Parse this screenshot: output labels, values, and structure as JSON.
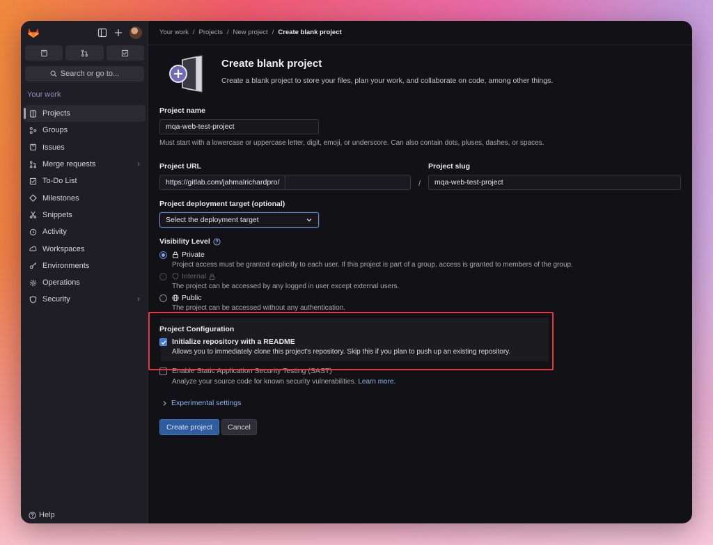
{
  "breadcrumb": [
    "Your work",
    "Projects",
    "New project",
    "Create blank project"
  ],
  "sidebar": {
    "search_label": "Search or go to...",
    "section_label": "Your work",
    "items": [
      {
        "label": "Projects",
        "icon": "project-icon",
        "active": true,
        "chevron": false
      },
      {
        "label": "Groups",
        "icon": "group-icon",
        "active": false,
        "chevron": false
      },
      {
        "label": "Issues",
        "icon": "issues-icon",
        "active": false,
        "chevron": false
      },
      {
        "label": "Merge requests",
        "icon": "merge-request-icon",
        "active": false,
        "chevron": true
      },
      {
        "label": "To-Do List",
        "icon": "todo-icon",
        "active": false,
        "chevron": false
      },
      {
        "label": "Milestones",
        "icon": "milestone-icon",
        "active": false,
        "chevron": false
      },
      {
        "label": "Snippets",
        "icon": "snippet-icon",
        "active": false,
        "chevron": false
      },
      {
        "label": "Activity",
        "icon": "activity-icon",
        "active": false,
        "chevron": false
      },
      {
        "label": "Workspaces",
        "icon": "workspace-icon",
        "active": false,
        "chevron": false
      },
      {
        "label": "Environments",
        "icon": "environment-icon",
        "active": false,
        "chevron": false
      },
      {
        "label": "Operations",
        "icon": "operations-icon",
        "active": false,
        "chevron": false
      },
      {
        "label": "Security",
        "icon": "shield-icon",
        "active": false,
        "chevron": true
      }
    ],
    "help_label": "Help"
  },
  "header": {
    "title": "Create blank project",
    "subtitle": "Create a blank project to store your files, plan your work, and collaborate on code, among other things."
  },
  "form": {
    "project_name_label": "Project name",
    "project_name_value": "mqa-web-test-project",
    "project_name_help": "Must start with a lowercase or uppercase letter, digit, emoji, or underscore. Can also contain dots, pluses, dashes, or spaces.",
    "project_url_label": "Project URL",
    "project_url_value": "https://gitlab.com/jahmalrichardpro/",
    "slash": "/",
    "project_slug_label": "Project slug",
    "project_slug_value": "mqa-web-test-project",
    "deployment_label": "Project deployment target (optional)",
    "deployment_value": "Select the deployment target",
    "visibility_label": "Visibility Level",
    "visibility": [
      {
        "title": "Private",
        "desc": "Project access must be granted explicitly to each user. If this project is part of a group, access is granted to members of the group."
      },
      {
        "title": "Internal",
        "desc": "The project can be accessed by any logged in user except external users."
      },
      {
        "title": "Public",
        "desc": "The project can be accessed without any authentication."
      }
    ],
    "config_label": "Project Configuration",
    "readme_title": "Initialize repository with a README",
    "readme_desc": "Allows you to immediately clone this project's repository. Skip this if you plan to push up an existing repository.",
    "sast_title": "Enable Static Application Security Testing (SAST)",
    "sast_desc": "Analyze your source code for known security vulnerabilities.",
    "sast_link": "Learn more.",
    "experimental_label": "Experimental settings",
    "create_button": "Create project",
    "cancel_button": "Cancel"
  },
  "colors": {
    "accent": "#3f7ad6",
    "highlight": "#e0383e",
    "link": "#8ab0ee"
  }
}
